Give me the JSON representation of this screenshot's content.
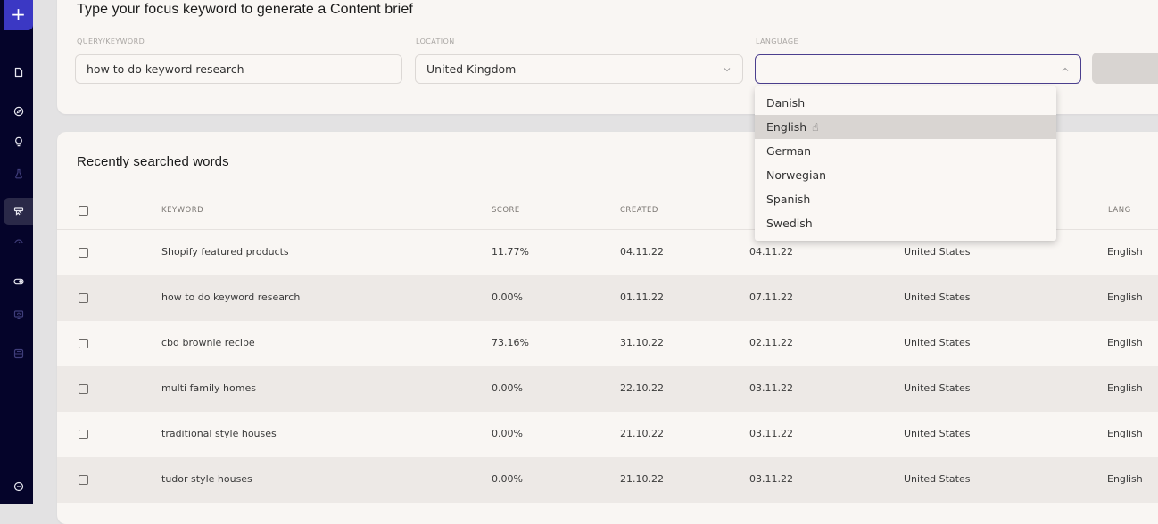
{
  "sidebar": {
    "new_button_icon": "plus-icon",
    "items": [
      {
        "name": "document-icon",
        "active": false,
        "dim": false
      },
      {
        "name": "compass-icon",
        "active": false,
        "dim": false
      },
      {
        "name": "lightbulb-icon",
        "active": false,
        "dim": false
      },
      {
        "name": "flask-icon",
        "active": false,
        "dim": true
      },
      {
        "name": "content-brief-icon",
        "active": true,
        "dim": false
      },
      {
        "name": "gauge-icon",
        "active": false,
        "dim": true
      },
      {
        "name": "toggle-icon",
        "active": false,
        "dim": false
      },
      {
        "name": "monitor-icon",
        "active": false,
        "dim": true
      },
      {
        "name": "grid-icon",
        "active": false,
        "dim": true
      }
    ],
    "bottom_icon": "collapse-icon"
  },
  "brief_form": {
    "title": "Type your focus keyword to generate a Content brief",
    "query_label": "QUERY/KEYWORD",
    "query_value": "how to do keyword research",
    "location_label": "LOCATION",
    "location_value": "United Kingdom",
    "language_label": "LANGUAGE",
    "language_value": "",
    "language_options": [
      "Danish",
      "English",
      "German",
      "Norwegian",
      "Spanish",
      "Swedish"
    ],
    "hovered_option": "English"
  },
  "recent": {
    "title": "Recently searched words",
    "columns": {
      "keyword": "KEYWORD",
      "score": "SCORE",
      "created": "CREATED",
      "lang": "LANG"
    },
    "rows": [
      {
        "keyword": "Shopify featured products",
        "score": "11.77%",
        "created": "04.11.22",
        "updated": "04.11.22",
        "location": "United States",
        "lang": "English"
      },
      {
        "keyword": "how to do keyword research",
        "score": "0.00%",
        "created": "01.11.22",
        "updated": "07.11.22",
        "location": "United States",
        "lang": "English"
      },
      {
        "keyword": "cbd brownie recipe",
        "score": "73.16%",
        "created": "31.10.22",
        "updated": "02.11.22",
        "location": "United States",
        "lang": "English"
      },
      {
        "keyword": "multi family homes",
        "score": "0.00%",
        "created": "22.10.22",
        "updated": "03.11.22",
        "location": "United States",
        "lang": "English"
      },
      {
        "keyword": "traditional style houses",
        "score": "0.00%",
        "created": "21.10.22",
        "updated": "03.11.22",
        "location": "United States",
        "lang": "English"
      },
      {
        "keyword": "tudor style houses",
        "score": "0.00%",
        "created": "21.10.22",
        "updated": "03.11.22",
        "location": "United States",
        "lang": "English"
      }
    ]
  },
  "colors": {
    "sidebar_bg": "#05042a",
    "accent": "#3b38c4",
    "focus_border": "#4b3f8e",
    "card_bg": "#f9f6f3",
    "row_alt": "#ede9e6"
  }
}
